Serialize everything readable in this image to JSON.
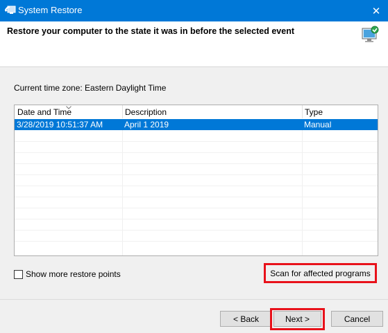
{
  "window": {
    "title": "System Restore",
    "close_glyph": "✕",
    "icon": "system-restore-icon"
  },
  "header": {
    "heading": "Restore your computer to the state it was in before the selected event",
    "icon": "restore-monitor-icon"
  },
  "timezone_label": "Current time zone: Eastern Daylight Time",
  "table": {
    "columns": [
      "Date and Time",
      "Description",
      "Type"
    ],
    "sort_indicator": "sort-arrow-icon",
    "rows": [
      {
        "date": "3/28/2019 10:51:37 AM",
        "description": "April 1 2019",
        "type": "Manual",
        "selected": true
      }
    ]
  },
  "show_more": {
    "label": "Show more restore points",
    "checked": false
  },
  "buttons": {
    "scan": "Scan for affected programs",
    "back": "< Back",
    "next": "Next >",
    "cancel": "Cancel"
  },
  "colors": {
    "titlebar": "#0078d7",
    "selection": "#0078d7",
    "highlight": "#e8111a"
  }
}
